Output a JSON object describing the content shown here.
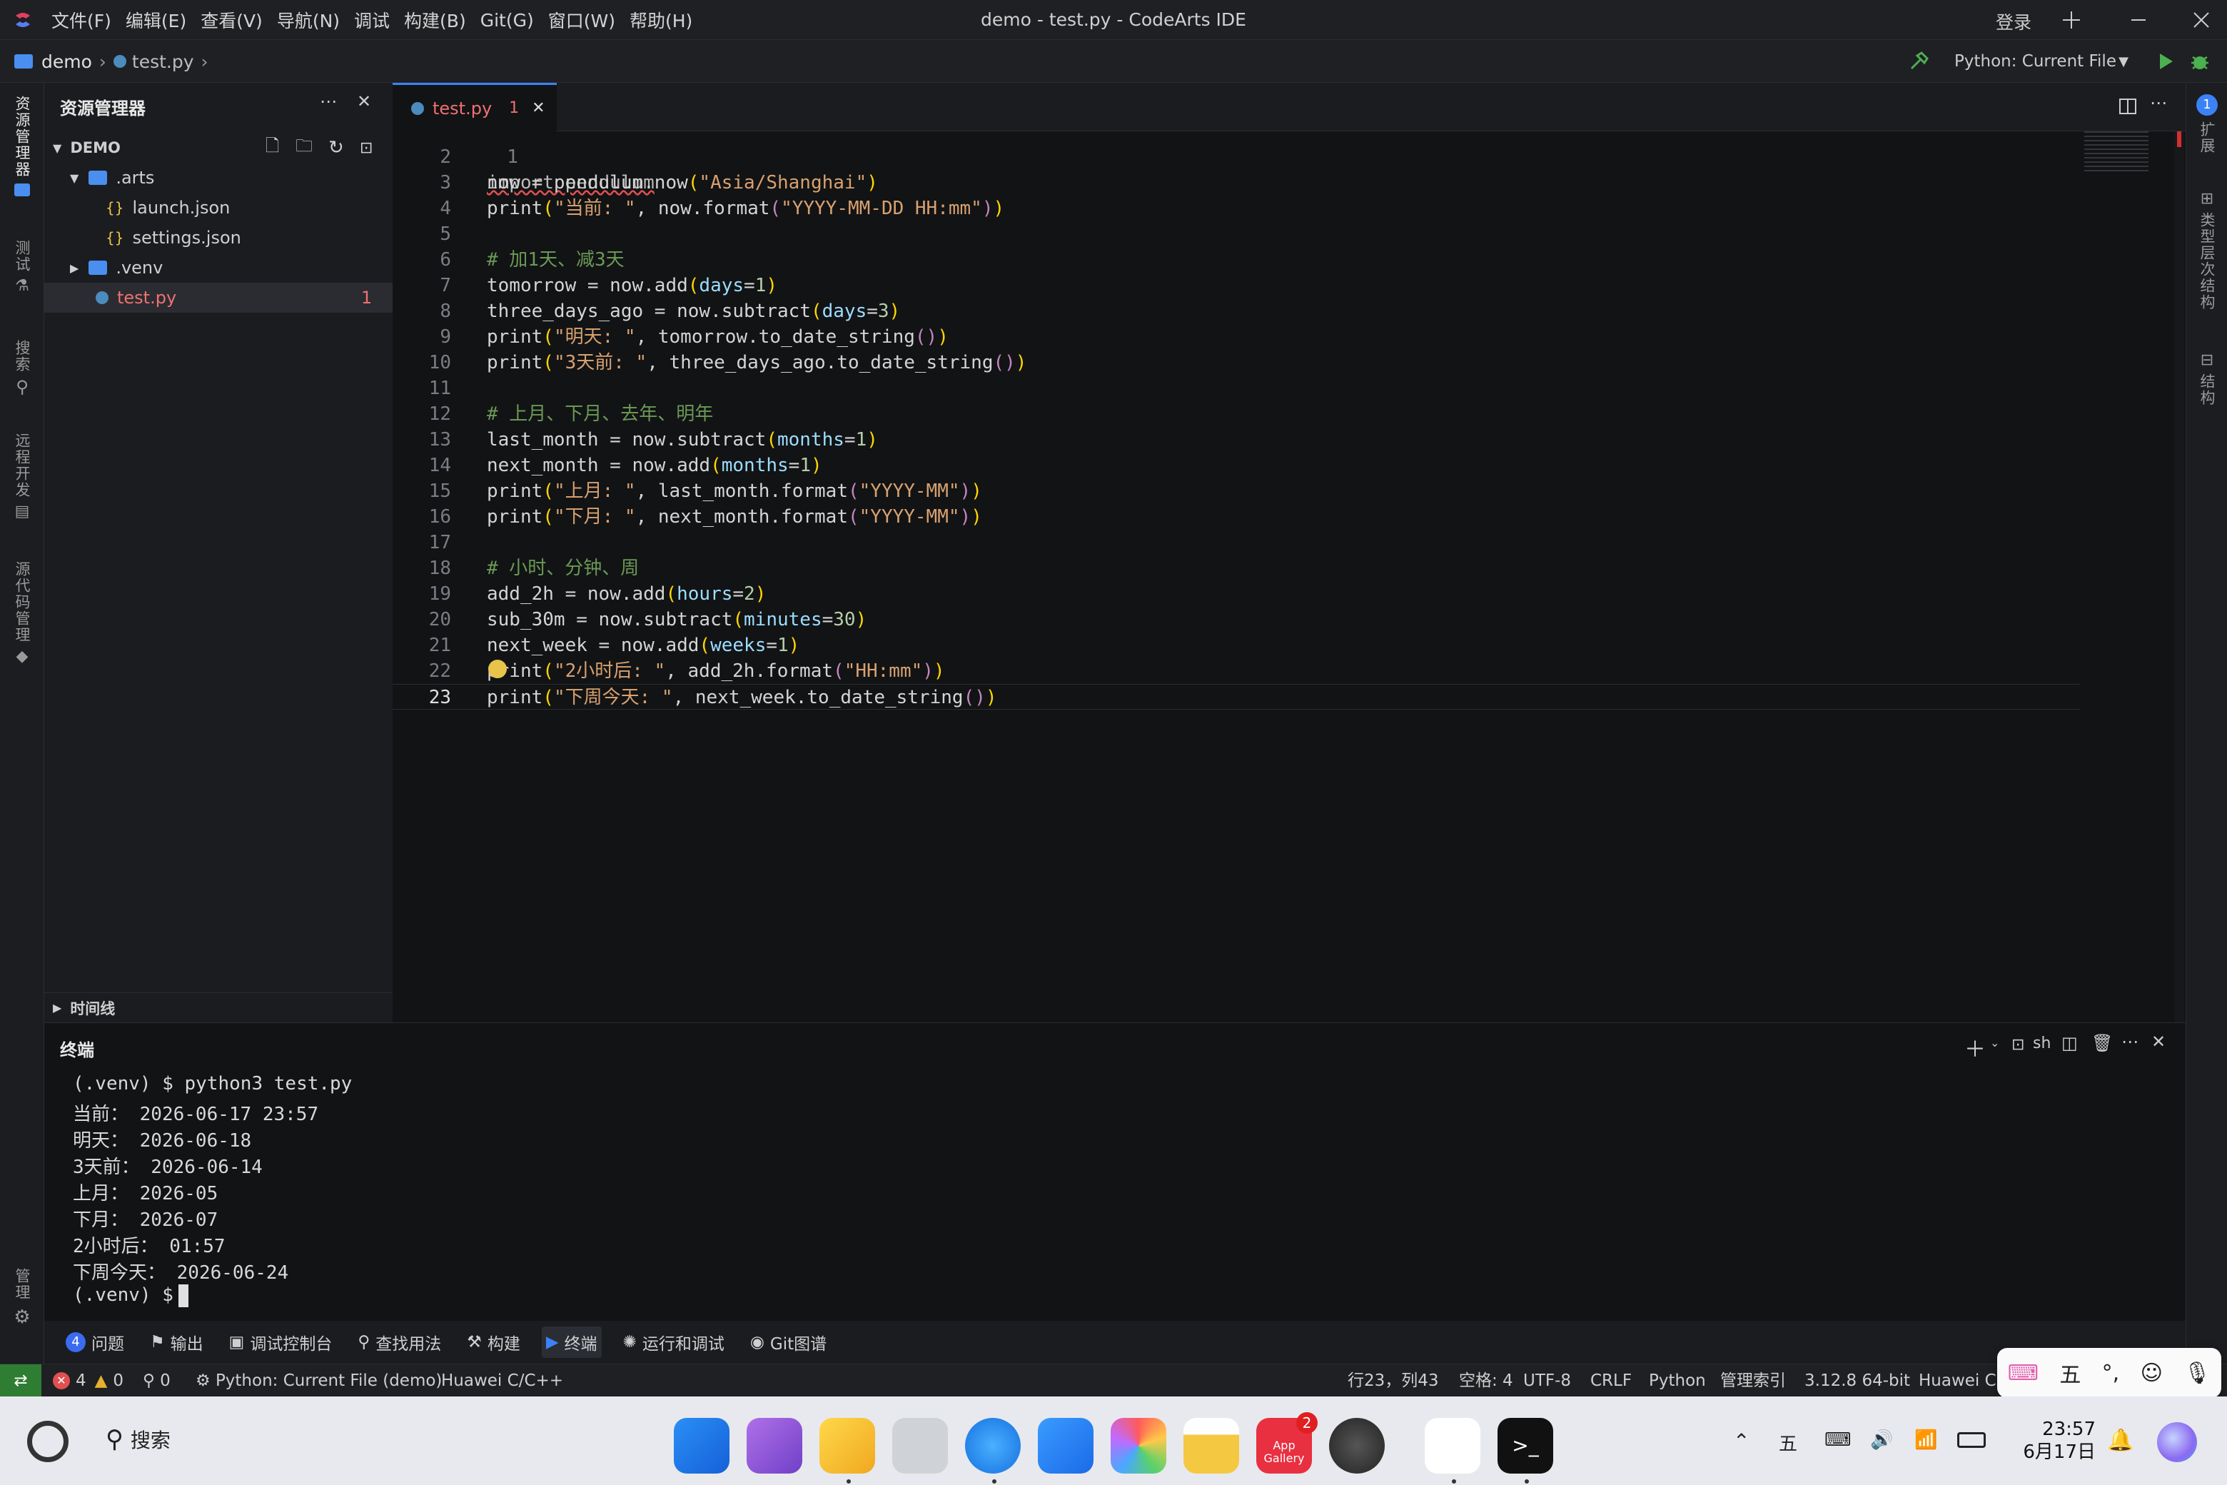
{
  "window": {
    "title": "demo - test.py - CodeArts IDE",
    "login": "登录"
  },
  "menu": [
    "文件(F)",
    "编辑(E)",
    "查看(V)",
    "导航(N)",
    "调试",
    "构建(B)",
    "Git(G)",
    "窗口(W)",
    "帮助(H)"
  ],
  "breadcrumb": {
    "project": "demo",
    "file": "test.py"
  },
  "run_config": "Python: Current File",
  "activity": {
    "explorer": "资源管理器",
    "test": "测试",
    "search": "搜索",
    "remote": "远程开发",
    "scm": "源代码管理",
    "manage": "管理"
  },
  "rightbar": {
    "ext": "扩展",
    "hierarchy": "类型层次结构",
    "structure": "结构",
    "badge": "1"
  },
  "explorer": {
    "title": "资源管理器",
    "root": "DEMO",
    "items": [
      ".arts",
      "launch.json",
      "settings.json",
      ".venv",
      "test.py"
    ],
    "test_badge": "1",
    "timeline": "时间线"
  },
  "tab": {
    "name": "test.py",
    "badge": "1"
  },
  "code": {
    "line1_cut": "import pendulum",
    "line_numbers": [
      "1",
      "2",
      "3",
      "4",
      "5",
      "6",
      "7",
      "8",
      "9",
      "10",
      "11",
      "12",
      "13",
      "14",
      "15",
      "16",
      "17",
      "18",
      "19",
      "20",
      "21",
      "22",
      "23"
    ]
  },
  "panel": {
    "title": "终端",
    "shell": "sh",
    "lines": [
      "(.venv) $ python3 test.py",
      "当前： 2026-06-17 23:57",
      "明天： 2026-06-18",
      "3天前： 2026-06-14",
      "上月： 2026-05",
      "下月： 2026-07",
      "2小时后： 01:57",
      "下周今天： 2026-06-24",
      "(.venv) $ "
    ]
  },
  "bottom_tabs": [
    {
      "label": "问题",
      "badge": "4"
    },
    {
      "label": "输出"
    },
    {
      "label": "调试控制台"
    },
    {
      "label": "查找用法"
    },
    {
      "label": "构建"
    },
    {
      "label": "终端"
    },
    {
      "label": "运行和调试"
    },
    {
      "label": "Git图谱"
    }
  ],
  "status": {
    "errors": "4",
    "warnings": "0",
    "ports": "0",
    "run": "Python: Current File (demo)",
    "cpp": "Huawei C/C++",
    "position": "行23，列43",
    "indent": "空格: 4",
    "encoding": "UTF-8",
    "eol": "CRLF",
    "lang": "Python",
    "index": "管理索引",
    "interpreter": "3.12.8 64-bit",
    "right_cut": "Huawei C"
  },
  "ime": {
    "mode": "五",
    "punct": "°,"
  },
  "taskbar": {
    "search": "搜索",
    "time": "23:57",
    "date": "6月17日",
    "appgallery_badge": "2",
    "appgallery_label": "App Gallery"
  }
}
